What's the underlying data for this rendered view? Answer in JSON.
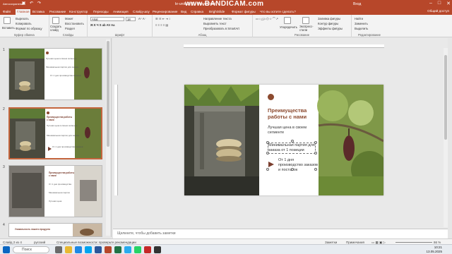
{
  "titlebar": {
    "autosave": "Автосохранение",
    "title": "kr-urok-2 (1) - PowerPoint",
    "watermark": "www.BANDICAM.com",
    "user": "Вход",
    "color_bg": "#b7472a"
  },
  "tabs": [
    {
      "label": "Файл"
    },
    {
      "label": "Главная"
    },
    {
      "label": "Вставка"
    },
    {
      "label": "Рисование"
    },
    {
      "label": "Конструктор"
    },
    {
      "label": "Переходы"
    },
    {
      "label": "Анимация"
    },
    {
      "label": "Слайд-шоу"
    },
    {
      "label": "Рецензирование"
    },
    {
      "label": "Вид"
    },
    {
      "label": "Справка"
    },
    {
      "label": "BrightSlide"
    },
    {
      "label": "Формат фигуры"
    },
    {
      "label": "Что вы хотите сделать?"
    }
  ],
  "share_label": "Общий доступ",
  "ribbon": {
    "clipboard": {
      "paste": "Вставить",
      "cut": "Вырезать",
      "copy": "Копировать",
      "format": "Формат по образцу",
      "label": "Буфер обмена"
    },
    "slides": {
      "new": "Создать слайд",
      "layout": "Макет",
      "reset": "Восстановить",
      "section": "Раздел",
      "label": "Слайды"
    },
    "font": {
      "name": "Arial",
      "size": "18",
      "label": "Шрифт"
    },
    "paragraph": {
      "label": "Абзац"
    },
    "text_dir": "Направление текста",
    "align_text": "Выровнять текст",
    "smartart": "Преобразовать в SmartArt",
    "drawing": {
      "arrange": "Упорядочить",
      "styles": "Экспресс-стили",
      "fill": "Заливка фигуры",
      "outline": "Контур фигуры",
      "effects": "Эффекты фигуры",
      "label": "Рисование"
    },
    "editing": {
      "find": "Найти",
      "replace": "Заменить",
      "select": "Выделить",
      "label": "Редактирование"
    }
  },
  "thumbs": [
    {
      "num": "1",
      "title": "Преимущества работы с нами",
      "lines": [
        "Лучшая цена в своем сегменте",
        "Минимальная партия для заказа",
        "От 1 дня производства заказов"
      ]
    },
    {
      "num": "2",
      "title": "Преимущества работы с нами",
      "lines": [
        "Лучшая цена в своем сегменте",
        "Минимальная партия для заказа",
        "От 1 дня производства заказов"
      ]
    },
    {
      "num": "3",
      "title": "Преимущества работы с нами",
      "lines": [
        "От 1 дня производства",
        "Минимальная партия",
        "Лучшая цена"
      ]
    },
    {
      "num": "4",
      "title": "Уникальность нашего продукта",
      "lines": []
    }
  ],
  "slide": {
    "title": "Преимущества работы с нами",
    "item1": "Лучшая цена в своем сегменте",
    "item2": "Минимальная партия для заказа от 1 позиции",
    "item3": "От 1 дня производство заказов и поставок",
    "accent": "#8c4a2f",
    "arrow_color": "#7a3e2e"
  },
  "notes_placeholder": "Щелкните, чтобы добавить заметки",
  "status": {
    "slide_of": "Слайд 2 из 4",
    "lang": "русский",
    "accessibility": "Специальные возможности: проверьте рекомендации",
    "notes": "Заметки",
    "comments": "Примечания",
    "zoom": "66 %"
  },
  "taskbar": {
    "search": "Поиск",
    "time": "10:21",
    "date": "13.05.2025"
  }
}
